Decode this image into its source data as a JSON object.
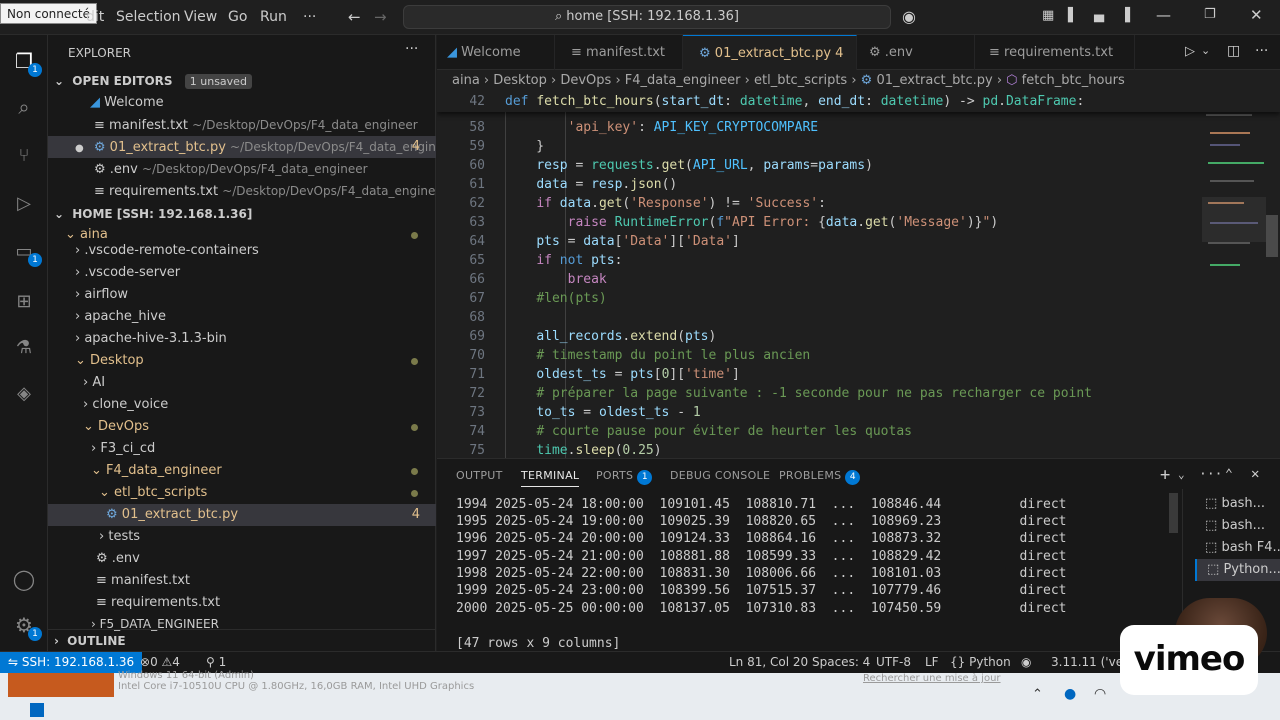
{
  "titlebar": {
    "status_label": "Non connecté",
    "menus": [
      "dit",
      "Selection",
      "View",
      "Go",
      "Run",
      "···"
    ],
    "search_text": "home [SSH: 192.168.1.36]"
  },
  "activity": {
    "explorer_badge": "1",
    "remote_badge": "1",
    "settings_badge": "1"
  },
  "sidebar": {
    "title": "EXPLORER",
    "open_editors_label": "OPEN EDITORS",
    "unsaved_badge": "1 unsaved",
    "open_editors": [
      {
        "name": "Welcome",
        "path": ""
      },
      {
        "name": "manifest.txt",
        "path": "~/Desktop/DevOps/F4_data_engineer"
      },
      {
        "name": "01_extract_btc.py",
        "path": "~/Desktop/DevOps/F4_data_engin...",
        "count": "4"
      },
      {
        "name": ".env",
        "path": "~/Desktop/DevOps/F4_data_engineer"
      },
      {
        "name": "requirements.txt",
        "path": "~/Desktop/DevOps/F4_data_engineer"
      }
    ],
    "home_label": "HOME [SSH: 192.168.1.36]",
    "tree": [
      {
        "name": "aina",
        "type": "folder-open"
      },
      {
        "name": ".vscode-remote-containers",
        "type": "folder"
      },
      {
        "name": ".vscode-server",
        "type": "folder"
      },
      {
        "name": "airflow",
        "type": "folder"
      },
      {
        "name": "apache_hive",
        "type": "folder"
      },
      {
        "name": "apache-hive-3.1.3-bin",
        "type": "folder"
      },
      {
        "name": "Desktop",
        "type": "folder-open"
      },
      {
        "name": "AI",
        "type": "folder"
      },
      {
        "name": "clone_voice",
        "type": "folder"
      },
      {
        "name": "DevOps",
        "type": "folder-open"
      },
      {
        "name": "F3_ci_cd",
        "type": "folder"
      },
      {
        "name": "F4_data_engineer",
        "type": "folder-open"
      },
      {
        "name": "etl_btc_scripts",
        "type": "folder-open"
      },
      {
        "name": "01_extract_btc.py",
        "type": "file",
        "count": "4"
      },
      {
        "name": "tests",
        "type": "folder"
      },
      {
        "name": ".env",
        "type": "file"
      },
      {
        "name": "manifest.txt",
        "type": "file"
      },
      {
        "name": "requirements.txt",
        "type": "file"
      },
      {
        "name": "F5_DATA_ENGINEER",
        "type": "folder"
      }
    ],
    "outline_label": "OUTLINE"
  },
  "tabs": [
    {
      "label": "Welcome"
    },
    {
      "label": "manifest.txt"
    },
    {
      "label": "01_extract_btc.py",
      "count": "4"
    },
    {
      "label": ".env"
    },
    {
      "label": "requirements.txt"
    }
  ],
  "breadcrumbs": [
    "aina",
    "Desktop",
    "DevOps",
    "F4_data_engineer",
    "etl_btc_scripts",
    "01_extract_btc.py",
    "fetch_btc_hours"
  ],
  "editor": {
    "sticky_line": "42",
    "line_numbers": [
      "58",
      "59",
      "60",
      "61",
      "62",
      "63",
      "64",
      "65",
      "66",
      "67",
      "68",
      "69",
      "70",
      "71",
      "72",
      "73",
      "74",
      "75"
    ]
  },
  "panel": {
    "tabs": [
      {
        "label": "OUTPUT"
      },
      {
        "label": "TERMINAL"
      },
      {
        "label": "PORTS",
        "badge": "1"
      },
      {
        "label": "DEBUG CONSOLE"
      },
      {
        "label": "PROBLEMS",
        "badge": "4"
      }
    ],
    "terminal_rows": [
      "1994 2025-05-24 18:00:00  109101.45  108810.71  ...  108846.44          direct",
      "1995 2025-05-24 19:00:00  109025.39  108820.65  ...  108969.23          direct",
      "1996 2025-05-24 20:00:00  109124.33  108864.16  ...  108873.32          direct",
      "1997 2025-05-24 21:00:00  108881.88  108599.33  ...  108829.42          direct",
      "1998 2025-05-24 22:00:00  108831.30  108006.66  ...  108101.03          direct",
      "1999 2025-05-24 23:00:00  108399.56  107515.37  ...  107779.46          direct",
      "2000 2025-05-25 00:00:00  108137.05  107310.83  ...  107450.59          direct"
    ],
    "summary": "[47 rows x 9 columns]",
    "sessions": [
      "bash...",
      "bash...",
      "bash F4...",
      "Python..."
    ]
  },
  "statusbar": {
    "remote": "SSH: 192.168.1.36",
    "errors": "0",
    "warnings": "4",
    "ports": "1",
    "position": "Ln 81, Col 20",
    "spaces": "Spaces: 4",
    "encoding": "UTF-8",
    "eol": "LF",
    "language": "Python",
    "interpreter": "3.11.11 ('ven"
  },
  "overlay": {
    "os_line1": "Windows 11 64-bit (Admin)",
    "os_line2": "Intel Core i7-10510U CPU @ 1.80GHz, 16,0GB RAM, Intel UHD Graphics",
    "update_text": "Rechercher une mise à jour",
    "brand": "vimeo"
  }
}
